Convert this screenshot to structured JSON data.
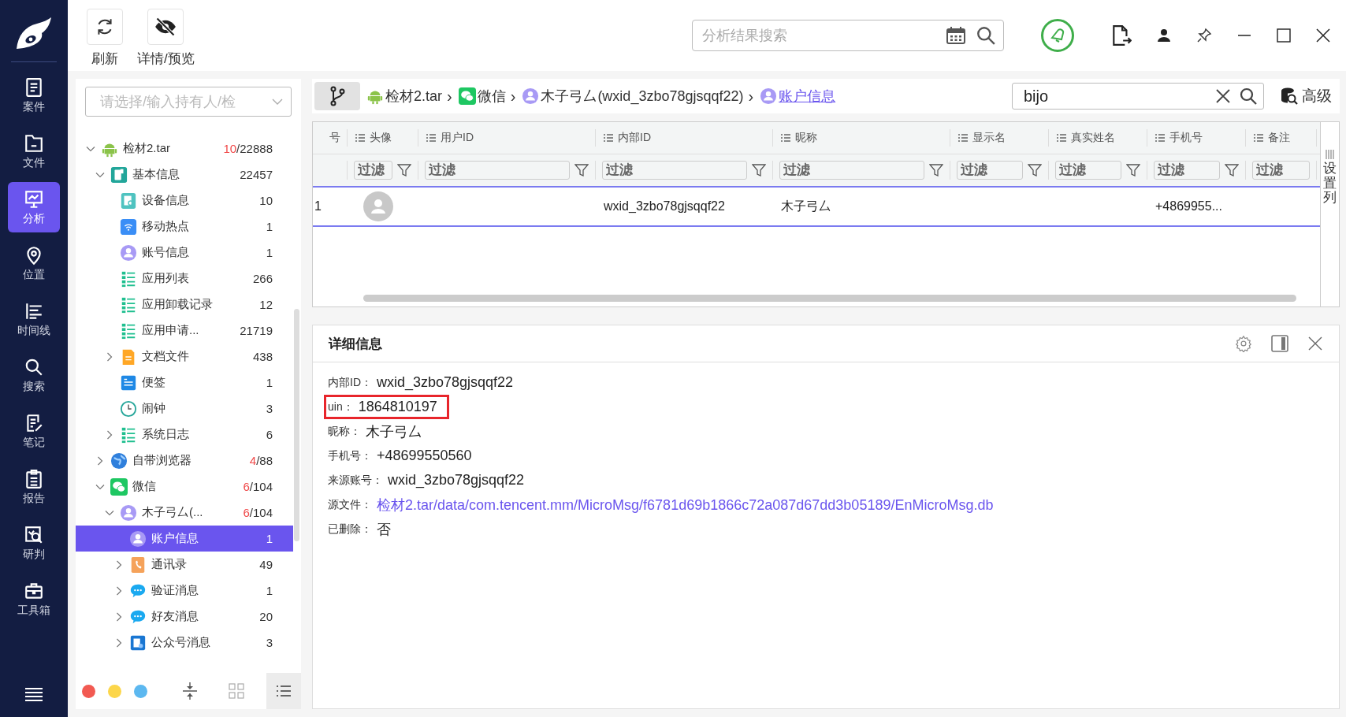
{
  "nav": {
    "items": [
      {
        "label": "案件",
        "kind": "case",
        "selected": false
      },
      {
        "label": "文件",
        "kind": "file",
        "selected": false
      },
      {
        "label": "分析",
        "kind": "analysis",
        "selected": true
      },
      {
        "label": "位置",
        "kind": "location",
        "selected": false
      },
      {
        "label": "时间线",
        "kind": "timeline",
        "selected": false
      },
      {
        "label": "搜索",
        "kind": "search",
        "selected": false
      },
      {
        "label": "笔记",
        "kind": "note",
        "selected": false
      },
      {
        "label": "报告",
        "kind": "report",
        "selected": false
      },
      {
        "label": "研判",
        "kind": "judge",
        "selected": false
      },
      {
        "label": "工具箱",
        "kind": "toolbox",
        "selected": false
      }
    ]
  },
  "toolbar": {
    "buttons": [
      {
        "label": "刷新",
        "kind": "refresh"
      },
      {
        "label": "详情/预览",
        "kind": "eye-off"
      }
    ],
    "search": {
      "placeholder": "分析结果搜索"
    }
  },
  "owner_select": {
    "placeholder": "请选择/输入持有人/检"
  },
  "tree": [
    {
      "label": "检材2.tar",
      "kind": "android",
      "hits": "10",
      "count": "/22888",
      "expanded": true,
      "selected": false,
      "children": [
        {
          "label": "基本信息",
          "kind": "info",
          "count": "22457",
          "expanded": true,
          "selected": false,
          "children": [
            {
              "label": "设备信息",
              "kind": "device",
              "count": "10",
              "selected": false
            },
            {
              "label": "移动热点",
              "kind": "wifi",
              "count": "1",
              "selected": false
            },
            {
              "label": "账号信息",
              "kind": "user",
              "count": "1",
              "selected": false
            },
            {
              "label": "应用列表",
              "kind": "list",
              "count": "266",
              "selected": false
            },
            {
              "label": "应用卸载记录",
              "kind": "list",
              "count": "12",
              "selected": false
            },
            {
              "label": "应用申请...",
              "kind": "list",
              "count": "21719",
              "selected": false
            },
            {
              "label": "文档文件",
              "kind": "doc",
              "count": "438",
              "expanded": false,
              "selected": false
            },
            {
              "label": "便签",
              "kind": "memo",
              "count": "1",
              "selected": false
            },
            {
              "label": "闹钟",
              "kind": "clock",
              "count": "3",
              "selected": false
            },
            {
              "label": "系统日志",
              "kind": "list",
              "count": "6",
              "expanded": false,
              "selected": false
            }
          ]
        },
        {
          "label": "自带浏览器",
          "kind": "globe",
          "hits": "4",
          "count": "/88",
          "expanded": false,
          "selected": false
        },
        {
          "label": "微信",
          "kind": "wechat",
          "hits": "6",
          "count": "/104",
          "expanded": true,
          "selected": false,
          "children": [
            {
              "label": "木子弓厶(...",
              "kind": "user",
              "hits": "6",
              "count": "/104",
              "expanded": true,
              "selected": false,
              "children": [
                {
                  "label": "账户信息",
                  "kind": "user",
                  "count": "1",
                  "selected": true
                },
                {
                  "label": "通讯录",
                  "kind": "contacts",
                  "count": "49",
                  "expanded": false,
                  "selected": false
                },
                {
                  "label": "验证消息",
                  "kind": "chat",
                  "count": "1",
                  "expanded": false,
                  "selected": false
                },
                {
                  "label": "好友消息",
                  "kind": "chat",
                  "count": "20",
                  "expanded": false,
                  "selected": false
                },
                {
                  "label": "公众号消息",
                  "kind": "article",
                  "count": "3",
                  "expanded": false,
                  "selected": false
                }
              ]
            }
          ]
        }
      ]
    }
  ],
  "color_filters": [
    {
      "color": "#f25a52"
    },
    {
      "color": "#fcd64a"
    },
    {
      "color": "#5cb8f0"
    }
  ],
  "view_modes": [
    {
      "kind": "collapse",
      "selected": false
    },
    {
      "kind": "grid",
      "selected": false
    },
    {
      "kind": "list",
      "selected": true
    }
  ],
  "breadcrumbs": [
    {
      "label": "检材2.tar",
      "kind": "android",
      "separator": "›",
      "current": false
    },
    {
      "label": "微信",
      "kind": "wechat",
      "separator": "›",
      "current": false
    },
    {
      "label": "木子弓厶(wxid_3zbo78gjsqqf22)",
      "kind": "user",
      "separator": "›",
      "current": false
    },
    {
      "label": "账户信息",
      "kind": "user",
      "current": true
    }
  ],
  "result_search": {
    "value": "bijo"
  },
  "advanced_button": {
    "label": "高级"
  },
  "table": {
    "columns": [
      {
        "label": "号"
      },
      {
        "label": "头像",
        "placeholder": "过滤"
      },
      {
        "label": "用户ID",
        "placeholder": "过滤"
      },
      {
        "label": "内部ID",
        "placeholder": "过滤"
      },
      {
        "label": "昵称",
        "placeholder": "过滤"
      },
      {
        "label": "显示名",
        "placeholder": "过滤"
      },
      {
        "label": "真实姓名",
        "placeholder": "过滤"
      },
      {
        "label": "手机号",
        "placeholder": "过滤"
      },
      {
        "label": "备注",
        "placeholder": "过滤"
      }
    ],
    "rows": [
      {
        "selected": true,
        "cells": [
          "1",
          {
            "kind": "avatar"
          },
          null,
          "wxid_3zbo78gjsqqf22",
          "木子弓厶",
          null,
          null,
          "+4869955...",
          null
        ]
      }
    ],
    "column_settings": "设置列"
  },
  "detail": {
    "title": "详细信息",
    "fields": [
      {
        "label": "内部ID：",
        "value": "wxid_3zbo78gjsqqf22",
        "kind": "text",
        "highlighted": false
      },
      {
        "label": "uin：",
        "value": "1864810197",
        "kind": "text",
        "highlighted": true
      },
      {
        "label": "昵称：",
        "value": "木子弓厶",
        "kind": "text",
        "highlighted": false
      },
      {
        "label": "手机号：",
        "value": "+48699550560",
        "kind": "text",
        "highlighted": false
      },
      {
        "label": "来源账号：",
        "value": "wxid_3zbo78gjsqqf22",
        "kind": "text",
        "highlighted": false
      },
      {
        "label": "源文件：",
        "value": "检材2.tar/data/com.tencent.mm/MicroMsg/f6781d69b1866c72a087d67dd3b05189/EnMicroMsg.db",
        "kind": "link",
        "highlighted": false
      },
      {
        "label": "已删除：",
        "value": "否",
        "kind": "text",
        "highlighted": false
      }
    ]
  }
}
